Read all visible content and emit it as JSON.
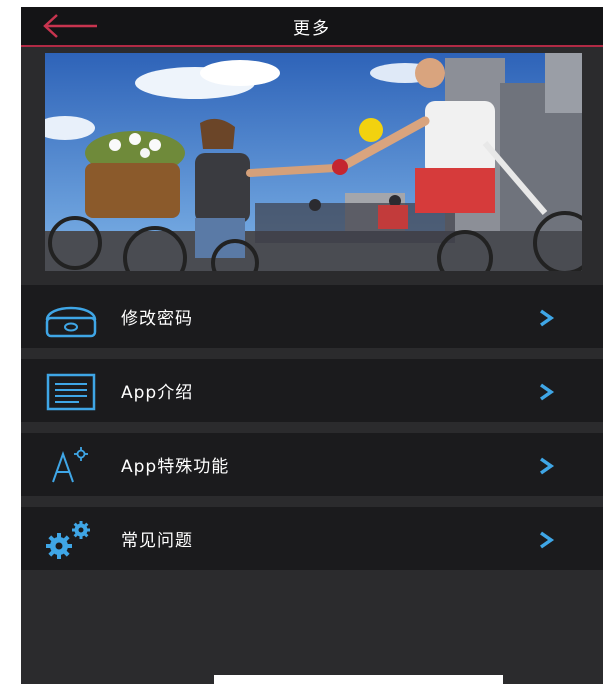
{
  "header": {
    "title": "更多",
    "back_icon": "back-arrow-icon"
  },
  "banner": {
    "alt": "cyclists-street-photo"
  },
  "menu": {
    "items": [
      {
        "label": "修改密码",
        "icon": "lock-icon"
      },
      {
        "label": "App介绍",
        "icon": "document-icon"
      },
      {
        "label": "App特殊功能",
        "icon": "special-feature-icon"
      },
      {
        "label": "常见问题",
        "icon": "gears-icon"
      }
    ]
  },
  "colors": {
    "accent": "#b12a45",
    "icon_blue": "#3fa6e6",
    "row_bg": "#1b1b1d",
    "page_bg": "#2b2b2d",
    "header_bg": "#141416"
  }
}
